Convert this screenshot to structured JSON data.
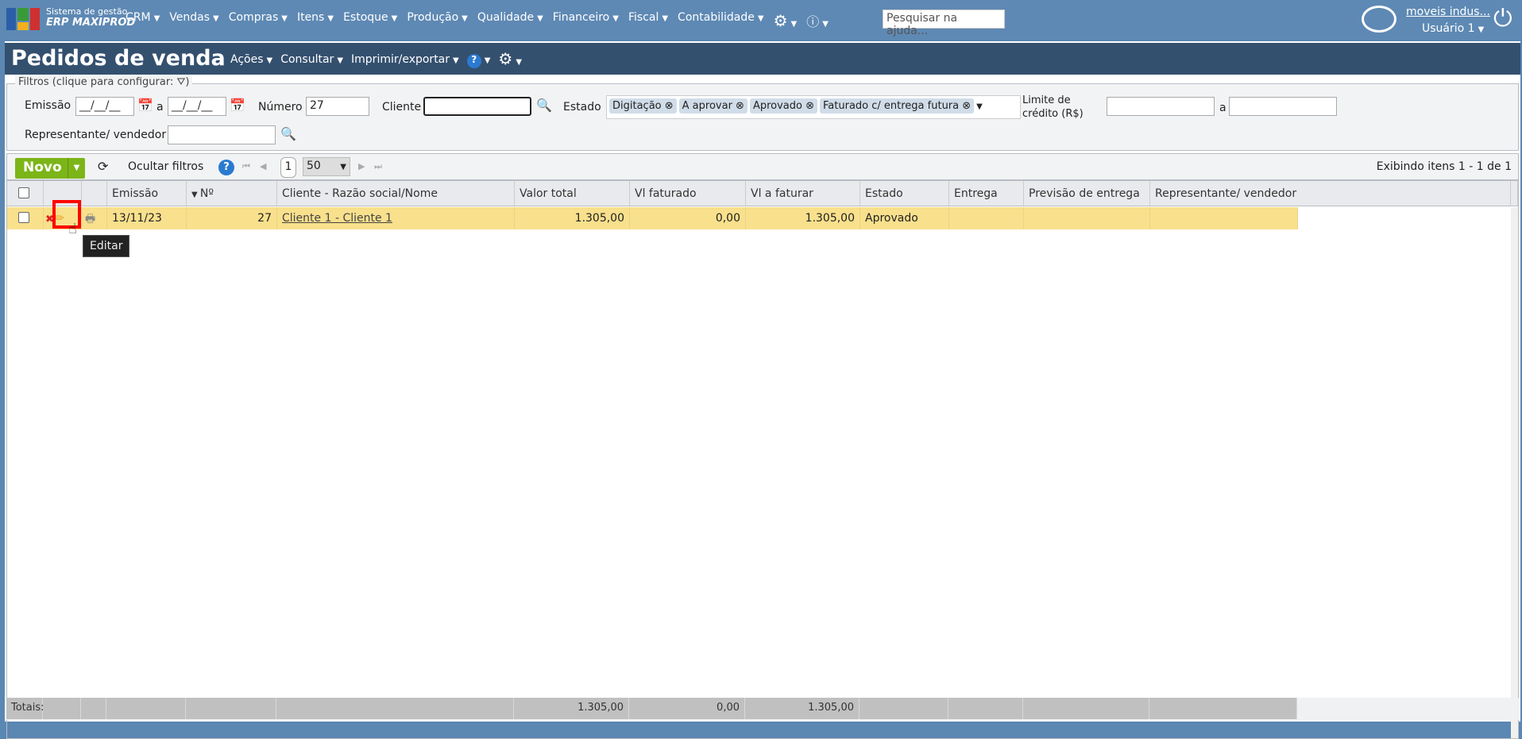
{
  "topbar": {
    "brand_line1": "Sistema de gestão",
    "brand_line2": "ERP MAXIPROD",
    "menu": [
      "CRM",
      "Vendas",
      "Compras",
      "Itens",
      "Estoque",
      "Produção",
      "Qualidade",
      "Financeiro",
      "Fiscal",
      "Contabilidade"
    ],
    "search_placeholder": "Pesquisar na ajuda...",
    "company": "moveis indus...",
    "user": "Usuário 1"
  },
  "page": {
    "title": "Pedidos de venda",
    "menu": [
      "Ações",
      "Consultar",
      "Imprimir/exportar"
    ]
  },
  "filters": {
    "legend": "Filtros (clique para configurar:",
    "legend_end": ")",
    "emissao_label": "Emissão",
    "date_placeholder": "__/__/__",
    "a": "a",
    "numero_label": "Número",
    "numero_value": "27",
    "cliente_label": "Cliente",
    "cliente_value": "",
    "estado_label": "Estado",
    "estado_chips": [
      "Digitação",
      "A aprovar",
      "Aprovado",
      "Faturado c/ entrega futura"
    ],
    "limite_label_1": "Limite de",
    "limite_label_2": "crédito (R$)",
    "representante_label": "Representante/ vendedor"
  },
  "toolbar": {
    "novo": "Novo",
    "ocultar": "Ocultar filtros",
    "page": "1",
    "page_size": "50",
    "info": "Exibindo itens 1 - 1 de 1"
  },
  "grid": {
    "columns": [
      "Emissão",
      "Nº",
      "Cliente - Razão social/Nome",
      "Valor total",
      "Vl faturado",
      "Vl a faturar",
      "Estado",
      "Entrega",
      "Previsão de entrega",
      "Representante/ vendedor"
    ],
    "rows": [
      {
        "emissao": "13/11/23",
        "numero": "27",
        "cliente": "Cliente 1 - Cliente 1",
        "valor_total": "1.305,00",
        "vl_faturado": "0,00",
        "vl_a_faturar": "1.305,00",
        "estado": "Aprovado",
        "entrega": "",
        "previsao": "",
        "representante": ""
      }
    ],
    "totals": {
      "label": "Totais:",
      "valor_total": "1.305,00",
      "vl_faturado": "0,00",
      "vl_a_faturar": "1.305,00"
    }
  },
  "tooltip": "Editar",
  "colors": {
    "topbar": "#5e89b4",
    "titlebar": "#34506f",
    "row_selected": "#f9e08c",
    "novo": "#7cb518",
    "highlight": "#ff0000"
  }
}
